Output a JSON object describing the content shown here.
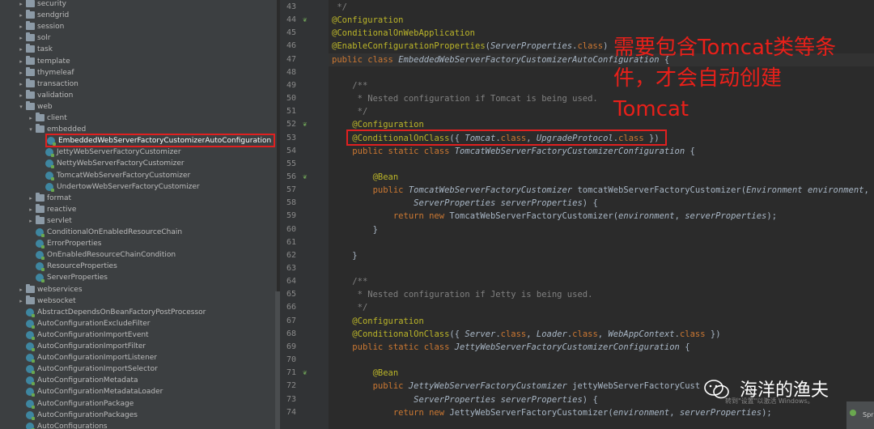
{
  "tree": {
    "rows": [
      {
        "label": "security",
        "kind": "folder",
        "depth": 1,
        "arrow": "▸"
      },
      {
        "label": "sendgrid",
        "kind": "folder",
        "depth": 1,
        "arrow": "▸"
      },
      {
        "label": "session",
        "kind": "folder",
        "depth": 1,
        "arrow": "▸"
      },
      {
        "label": "solr",
        "kind": "folder",
        "depth": 1,
        "arrow": "▸"
      },
      {
        "label": "task",
        "kind": "folder",
        "depth": 1,
        "arrow": "▸"
      },
      {
        "label": "template",
        "kind": "folder",
        "depth": 1,
        "arrow": "▸"
      },
      {
        "label": "thymeleaf",
        "kind": "folder",
        "depth": 1,
        "arrow": "▸"
      },
      {
        "label": "transaction",
        "kind": "folder",
        "depth": 1,
        "arrow": "▸"
      },
      {
        "label": "validation",
        "kind": "folder",
        "depth": 1,
        "arrow": "▸"
      },
      {
        "label": "web",
        "kind": "folder",
        "depth": 1,
        "arrow": "▾"
      },
      {
        "label": "client",
        "kind": "folder",
        "depth": 2,
        "arrow": "▸"
      },
      {
        "label": "embedded",
        "kind": "folder",
        "depth": 2,
        "arrow": "▾"
      },
      {
        "label": "EmbeddedWebServerFactoryCustomizerAutoConfiguration",
        "kind": "class",
        "depth": 3,
        "arrow": "",
        "selected": true
      },
      {
        "label": "JettyWebServerFactoryCustomizer",
        "kind": "class",
        "depth": 3,
        "arrow": ""
      },
      {
        "label": "NettyWebServerFactoryCustomizer",
        "kind": "class",
        "depth": 3,
        "arrow": ""
      },
      {
        "label": "TomcatWebServerFactoryCustomizer",
        "kind": "class",
        "depth": 3,
        "arrow": ""
      },
      {
        "label": "UndertowWebServerFactoryCustomizer",
        "kind": "class",
        "depth": 3,
        "arrow": ""
      },
      {
        "label": "format",
        "kind": "folder",
        "depth": 2,
        "arrow": "▸"
      },
      {
        "label": "reactive",
        "kind": "folder",
        "depth": 2,
        "arrow": "▸"
      },
      {
        "label": "servlet",
        "kind": "folder",
        "depth": 2,
        "arrow": "▸"
      },
      {
        "label": "ConditionalOnEnabledResourceChain",
        "kind": "class",
        "depth": 2,
        "arrow": ""
      },
      {
        "label": "ErrorProperties",
        "kind": "class",
        "depth": 2,
        "arrow": ""
      },
      {
        "label": "OnEnabledResourceChainCondition",
        "kind": "class",
        "depth": 2,
        "arrow": ""
      },
      {
        "label": "ResourceProperties",
        "kind": "class",
        "depth": 2,
        "arrow": ""
      },
      {
        "label": "ServerProperties",
        "kind": "class",
        "depth": 2,
        "arrow": ""
      },
      {
        "label": "webservices",
        "kind": "folder",
        "depth": 1,
        "arrow": "▸"
      },
      {
        "label": "websocket",
        "kind": "folder",
        "depth": 1,
        "arrow": "▸"
      },
      {
        "label": "AbstractDependsOnBeanFactoryPostProcessor",
        "kind": "class",
        "depth": 1,
        "arrow": ""
      },
      {
        "label": "AutoConfigurationExcludeFilter",
        "kind": "class",
        "depth": 1,
        "arrow": ""
      },
      {
        "label": "AutoConfigurationImportEvent",
        "kind": "class",
        "depth": 1,
        "arrow": ""
      },
      {
        "label": "AutoConfigurationImportFilter",
        "kind": "class",
        "depth": 1,
        "arrow": ""
      },
      {
        "label": "AutoConfigurationImportListener",
        "kind": "class",
        "depth": 1,
        "arrow": ""
      },
      {
        "label": "AutoConfigurationImportSelector",
        "kind": "class",
        "depth": 1,
        "arrow": ""
      },
      {
        "label": "AutoConfigurationMetadata",
        "kind": "class",
        "depth": 1,
        "arrow": ""
      },
      {
        "label": "AutoConfigurationMetadataLoader",
        "kind": "class",
        "depth": 1,
        "arrow": ""
      },
      {
        "label": "AutoConfigurationPackage",
        "kind": "class",
        "depth": 1,
        "arrow": ""
      },
      {
        "label": "AutoConfigurationPackages",
        "kind": "class",
        "depth": 1,
        "arrow": ""
      },
      {
        "label": "AutoConfigurations",
        "kind": "class",
        "depth": 1,
        "arrow": ""
      }
    ]
  },
  "editor": {
    "lines": [
      {
        "n": "43",
        "icon": "",
        "html": "<span class=\"cmt\"> */</span>"
      },
      {
        "n": "44",
        "icon": "bean-gutter-icon",
        "html": "<span class=\"ann\">@Configuration</span>"
      },
      {
        "n": "45",
        "icon": "",
        "html": "<span class=\"ann\">@ConditionalOnWebApplication</span>"
      },
      {
        "n": "46",
        "icon": "",
        "html": "<span class=\"ann\">@EnableConfigurationProperties</span>(<span class=\"type-it\">ServerProperties</span>.<span class=\"kw\">class</span>)"
      },
      {
        "n": "47",
        "icon": "",
        "html": "<span class=\"kw\">public class </span><span class=\"type-it\">EmbeddedWebServerFactoryCustomizerAutoConfiguration</span> {"
      },
      {
        "n": "48",
        "icon": "",
        "html": ""
      },
      {
        "n": "49",
        "icon": "",
        "html": "    <span class=\"cmt\">/**</span>"
      },
      {
        "n": "50",
        "icon": "",
        "html": "    <span class=\"cmt\"> * Nested configuration if Tomcat is being used.</span>"
      },
      {
        "n": "51",
        "icon": "",
        "html": "    <span class=\"cmt\"> */</span>"
      },
      {
        "n": "52",
        "icon": "bean-gutter-icon",
        "html": "    <span class=\"ann\">@Configuration</span>"
      },
      {
        "n": "53",
        "icon": "",
        "html": "    <span class=\"ann\">@ConditionalOnClass</span>({ <span class=\"type-it\">Tomcat</span>.<span class=\"kw\">class</span>, <span class=\"type-it\">UpgradeProtocol</span>.<span class=\"kw\">class</span> })"
      },
      {
        "n": "54",
        "icon": "",
        "html": "    <span class=\"kw\">public static class </span><span class=\"type-it\">TomcatWebServerFactoryCustomizerConfiguration</span> {"
      },
      {
        "n": "55",
        "icon": "",
        "html": ""
      },
      {
        "n": "56",
        "icon": "bean-gutter-icon",
        "html": "        <span class=\"ann\">@Bean</span>"
      },
      {
        "n": "57",
        "icon": "",
        "html": "        <span class=\"kw\">public </span><span class=\"type-it\">TomcatWebServerFactoryCustomizer</span> tomcatWebServerFactoryCustomizer(<span class=\"type-it\">Environment</span> <span class=\"it\">environment</span>,"
      },
      {
        "n": "58",
        "icon": "",
        "html": "                <span class=\"type-it\">ServerProperties</span> <span class=\"it\">serverProperties</span>) {"
      },
      {
        "n": "59",
        "icon": "",
        "html": "            <span class=\"ret\">return new </span>TomcatWebServerFactoryCustomizer(<span class=\"it\">environment</span>, <span class=\"it\">serverProperties</span>);"
      },
      {
        "n": "60",
        "icon": "",
        "html": "        }"
      },
      {
        "n": "61",
        "icon": "",
        "html": ""
      },
      {
        "n": "62",
        "icon": "",
        "html": "    }"
      },
      {
        "n": "63",
        "icon": "",
        "html": ""
      },
      {
        "n": "64",
        "icon": "",
        "html": "    <span class=\"cmt\">/**</span>"
      },
      {
        "n": "65",
        "icon": "",
        "html": "    <span class=\"cmt\"> * Nested configuration if Jetty is being used.</span>"
      },
      {
        "n": "66",
        "icon": "",
        "html": "    <span class=\"cmt\"> */</span>"
      },
      {
        "n": "67",
        "icon": "",
        "html": "    <span class=\"ann\">@Configuration</span>"
      },
      {
        "n": "68",
        "icon": "",
        "html": "    <span class=\"ann\">@ConditionalOnClass</span>({ <span class=\"type-it\">Server</span>.<span class=\"kw\">class</span>, <span class=\"type-it\">Loader</span>.<span class=\"kw\">class</span>, <span class=\"type-it\">WebAppContext</span>.<span class=\"kw\">class</span> })"
      },
      {
        "n": "69",
        "icon": "",
        "html": "    <span class=\"kw\">public static class </span><span class=\"type-it\">JettyWebServerFactoryCustomizerConfiguration</span> {"
      },
      {
        "n": "70",
        "icon": "",
        "html": ""
      },
      {
        "n": "71",
        "icon": "bean-gutter-icon",
        "html": "        <span class=\"ann\">@Bean</span>"
      },
      {
        "n": "72",
        "icon": "",
        "html": "        <span class=\"kw\">public </span><span class=\"type-it\">JettyWebServerFactoryCustomizer</span> jettyWebServerFactoryCust"
      },
      {
        "n": "73",
        "icon": "",
        "html": "                <span class=\"type-it\">ServerProperties</span> <span class=\"it\">serverProperties</span>) {"
      },
      {
        "n": "74",
        "icon": "",
        "html": "            <span class=\"ret\">return new </span>JettyWebServerFactoryCustomizer(<span class=\"it\">environment</span>, <span class=\"it\">serverProperties</span>);"
      }
    ]
  },
  "annotation": {
    "callout_text": "需要包含Tomcat类等条件，才会自动创建Tomcat"
  },
  "watermark": {
    "text": "海洋的渔夫",
    "activate_text": "转到\"设置\"以激活 Windows。"
  },
  "corner": {
    "label": "Spr"
  },
  "colors": {
    "accent_red": "#e02020",
    "annotation": "#bbb529",
    "keyword": "#cc7832"
  }
}
